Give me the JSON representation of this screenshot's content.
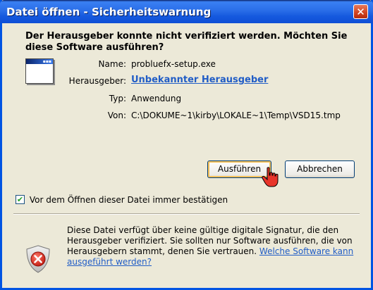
{
  "window": {
    "title": "Datei öffnen - Sicherheitswarnung",
    "close_glyph": "✕"
  },
  "heading": "Der Herausgeber konnte nicht verifiziert werden. Möchten Sie diese Software ausführen?",
  "file_icon": "application-window-icon",
  "fields": {
    "name_label": "Name:",
    "name_value": "probluefx-setup.exe",
    "publisher_label": "Herausgeber:",
    "publisher_value": "Unbekannter Herausgeber",
    "type_label": "Typ:",
    "type_value": "Anwendung",
    "from_label": "Von:",
    "from_value": "C:\\DOKUME~1\\kirby\\LOKALE~1\\Temp\\VSD15.tmp"
  },
  "buttons": {
    "run": "Ausführen",
    "cancel": "Abbrechen"
  },
  "checkbox": {
    "label": "Vor dem Öffnen dieser Datei immer bestätigen",
    "checked": true,
    "check_glyph": "✔"
  },
  "warning": {
    "icon": "security-shield-icon",
    "text": "Diese Datei verfügt über keine gültige digitale Signatur, die den Herausgeber verifiziert. Sie sollten nur Software ausführen, die von Herausgebern stammt, denen Sie vertrauen.",
    "link": "Welche Software kann ausgeführt werden?"
  },
  "colors": {
    "titlebar": "#0a5ce0",
    "link": "#215dc6",
    "shield_red": "#d0261e"
  }
}
